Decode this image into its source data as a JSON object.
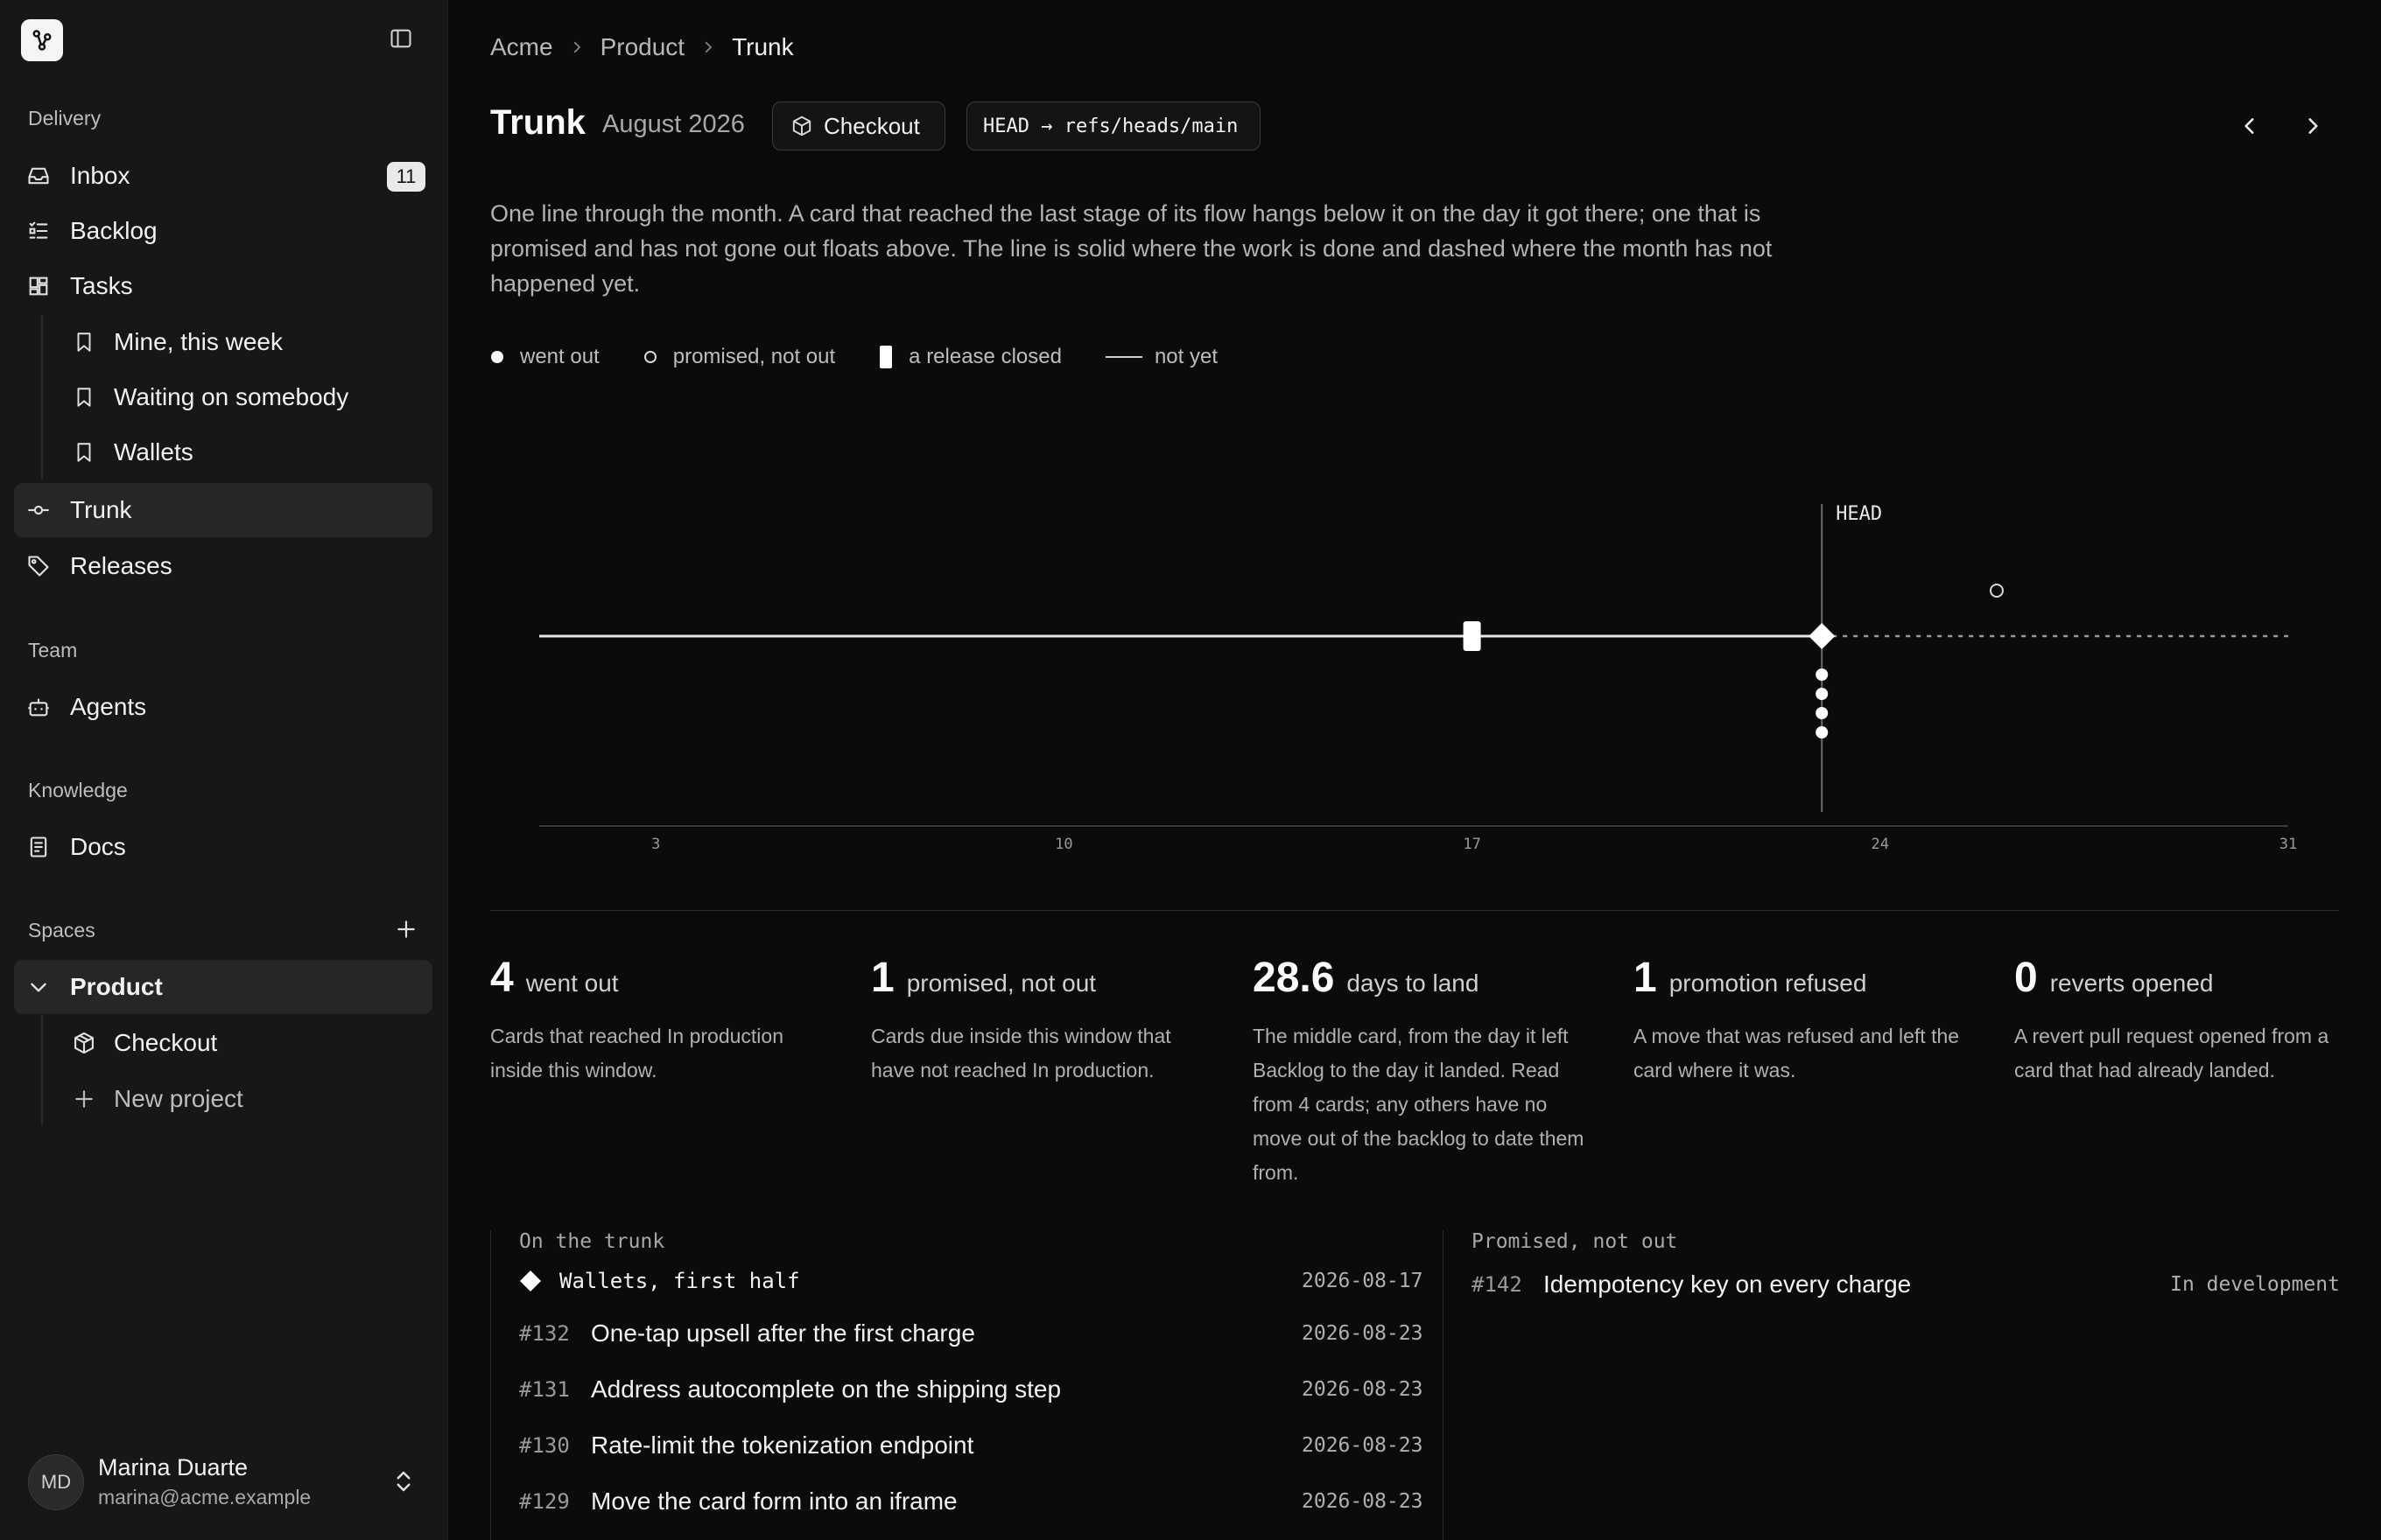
{
  "sidebar": {
    "sections": {
      "delivery": "Delivery",
      "team": "Team",
      "knowledge": "Knowledge",
      "spaces": "Spaces"
    },
    "inbox": {
      "label": "Inbox",
      "count": "11"
    },
    "backlog": "Backlog",
    "tasks": "Tasks",
    "views": [
      "Mine, this week",
      "Waiting on somebody",
      "Wallets"
    ],
    "trunk": "Trunk",
    "releases": "Releases",
    "agents": "Agents",
    "docs": "Docs",
    "space": "Product",
    "project": "Checkout",
    "new_project": "New project",
    "user": {
      "initials": "MD",
      "name": "Marina Duarte",
      "email": "marina@acme.example"
    }
  },
  "breadcrumb": [
    "Acme",
    "Product",
    "Trunk"
  ],
  "header": {
    "title": "Trunk",
    "period": "August 2026",
    "project_pill": "Checkout",
    "ref_pill": "HEAD → refs/heads/main"
  },
  "description": "One line through the month. A card that reached the last stage of its flow hangs below it on the day it got there; one that is promised and has not gone out floats above. The line is solid where the work is done and dashed where the month has not happened yet.",
  "legend": [
    "went out",
    "promised, not out",
    "a release closed",
    "not yet"
  ],
  "chart_data": {
    "type": "timeline",
    "x_ticks": [
      "3",
      "10",
      "17",
      "24",
      "31"
    ],
    "xlim": [
      1,
      31
    ],
    "head_day": 23,
    "head_label": "HEAD",
    "release_closed_days": [
      17
    ],
    "went_out": [
      {
        "day": 23,
        "count": 4
      }
    ],
    "promised_not_out": [
      {
        "day": 26,
        "count": 1
      }
    ]
  },
  "stats": [
    {
      "value": "4",
      "unit": "went out",
      "desc": "Cards that reached In production inside this window."
    },
    {
      "value": "1",
      "unit": "promised, not out",
      "desc": "Cards due inside this window that have not reached In production."
    },
    {
      "value": "28.6",
      "unit": "days to land",
      "desc": "The middle card, from the day it left Backlog to the day it landed. Read from 4 cards; any others have no move out of the backlog to date them from."
    },
    {
      "value": "1",
      "unit": "promotion refused",
      "desc": "A move that was refused and left the card where it was."
    },
    {
      "value": "0",
      "unit": "reverts opened",
      "desc": "A revert pull request opened from a card that had already landed."
    }
  ],
  "on_trunk": {
    "heading": "On the trunk",
    "release": {
      "name": "Wallets, first half",
      "date": "2026-08-17"
    },
    "items": [
      {
        "id": "#132",
        "title": "One-tap upsell after the first charge",
        "date": "2026-08-23"
      },
      {
        "id": "#131",
        "title": "Address autocomplete on the shipping step",
        "date": "2026-08-23"
      },
      {
        "id": "#130",
        "title": "Rate-limit the tokenization endpoint",
        "date": "2026-08-23"
      },
      {
        "id": "#129",
        "title": "Move the card form into an iframe",
        "date": "2026-08-23"
      }
    ]
  },
  "promised": {
    "heading": "Promised, not out",
    "items": [
      {
        "id": "#142",
        "title": "Idempotency key on every charge",
        "status": "In development"
      }
    ]
  }
}
